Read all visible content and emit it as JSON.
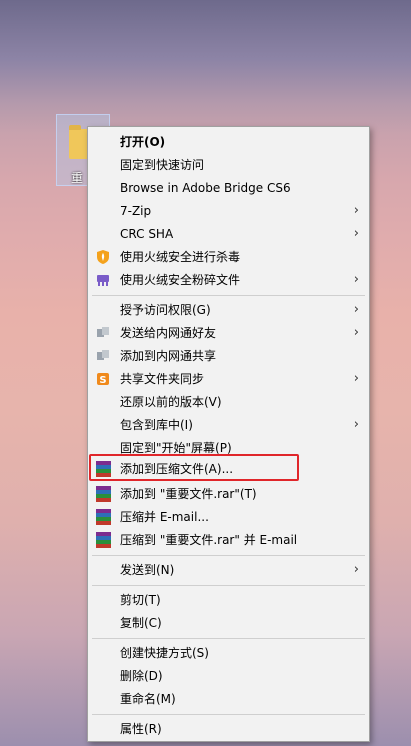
{
  "desktop": {
    "icon_label": "重"
  },
  "menu": {
    "items": [
      {
        "label": "打开(O)"
      },
      {
        "label": "固定到快速访问"
      },
      {
        "label": "Browse in Adobe Bridge CS6"
      },
      {
        "label": "7-Zip",
        "arrow": "›"
      },
      {
        "label": "CRC SHA",
        "arrow": "›"
      },
      {
        "label": "使用火绒安全进行杀毒"
      },
      {
        "label": "使用火绒安全粉碎文件",
        "arrow": "›"
      },
      {
        "label": "授予访问权限(G)",
        "arrow": "›"
      },
      {
        "label": "发送给内网通好友",
        "arrow": "›"
      },
      {
        "label": "添加到内网通共享"
      },
      {
        "label": "共享文件夹同步",
        "arrow": "›"
      },
      {
        "label": "还原以前的版本(V)"
      },
      {
        "label": "包含到库中(I)",
        "arrow": "›"
      },
      {
        "label": "固定到\"开始\"屏幕(P)"
      },
      {
        "label": "添加到压缩文件(A)..."
      },
      {
        "label": "添加到 \"重要文件.rar\"(T)"
      },
      {
        "label": "压缩并 E-mail..."
      },
      {
        "label": "压缩到 \"重要文件.rar\" 并 E-mail"
      },
      {
        "label": "发送到(N)",
        "arrow": "›"
      },
      {
        "label": "剪切(T)"
      },
      {
        "label": "复制(C)"
      },
      {
        "label": "创建快捷方式(S)"
      },
      {
        "label": "删除(D)"
      },
      {
        "label": "重命名(M)"
      },
      {
        "label": "属性(R)"
      }
    ]
  },
  "colors": {
    "highlight_border": "#e0262a",
    "menu_bg": "#f2f2f2"
  }
}
